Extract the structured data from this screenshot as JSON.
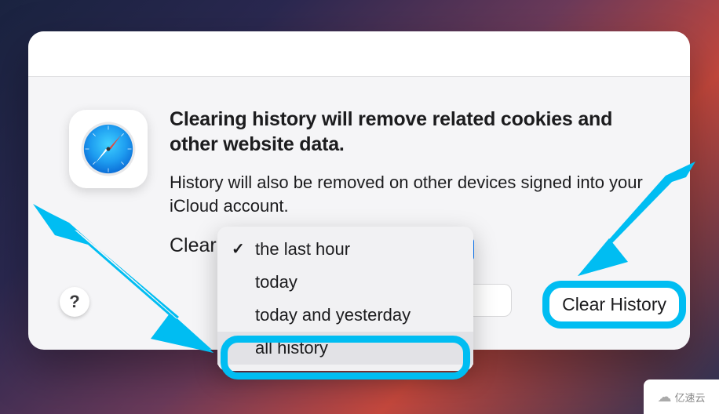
{
  "dialog": {
    "headline": "Clearing history will remove related cookies and other website data.",
    "subtext": "History will also be removed on other devices signed into your iCloud account.",
    "clear_label_prefix": "Clear",
    "help_label": "?",
    "clear_history_button": "Clear History"
  },
  "dropdown": {
    "options": [
      "the last hour",
      "today",
      "today and yesterday",
      "all history"
    ],
    "selected_index": 0,
    "highlighted_index": 3
  },
  "icons": {
    "app": "safari-icon",
    "help": "help-icon"
  },
  "watermark": {
    "text": "亿速云"
  },
  "annotations": {
    "arrow_left": "annotation-arrow",
    "arrow_right": "annotation-arrow"
  }
}
